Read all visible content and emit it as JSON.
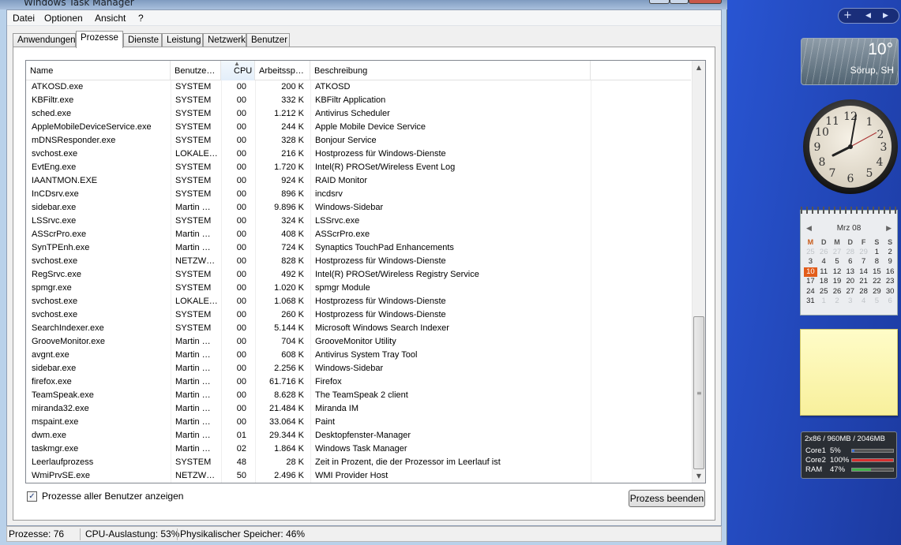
{
  "window": {
    "title": "Windows Task Manager"
  },
  "menu": [
    "Datei",
    "Optionen",
    "Ansicht",
    "?"
  ],
  "tabs": [
    "Anwendungen",
    "Prozesse",
    "Dienste",
    "Leistung",
    "Netzwerk",
    "Benutzer"
  ],
  "active_tab": "Prozesse",
  "columns": {
    "name": "Name",
    "user": "Benutze…",
    "cpu": "CPU",
    "mem": "Arbeitssp…",
    "desc": "Beschreibung"
  },
  "processes": [
    {
      "name": "ATKOSD.exe",
      "user": "SYSTEM",
      "cpu": "00",
      "mem": "200 K",
      "desc": "ATKOSD"
    },
    {
      "name": "KBFiltr.exe",
      "user": "SYSTEM",
      "cpu": "00",
      "mem": "332 K",
      "desc": "KBFiltr Application"
    },
    {
      "name": "sched.exe",
      "user": "SYSTEM",
      "cpu": "00",
      "mem": "1.212 K",
      "desc": "Antivirus Scheduler"
    },
    {
      "name": "AppleMobileDeviceService.exe",
      "user": "SYSTEM",
      "cpu": "00",
      "mem": "244 K",
      "desc": "Apple Mobile Device Service"
    },
    {
      "name": "mDNSResponder.exe",
      "user": "SYSTEM",
      "cpu": "00",
      "mem": "328 K",
      "desc": "Bonjour Service"
    },
    {
      "name": "svchost.exe",
      "user": "LOKALE…",
      "cpu": "00",
      "mem": "216 K",
      "desc": "Hostprozess für Windows-Dienste"
    },
    {
      "name": "EvtEng.exe",
      "user": "SYSTEM",
      "cpu": "00",
      "mem": "1.720 K",
      "desc": "Intel(R) PROSet/Wireless Event Log"
    },
    {
      "name": "IAANTMON.EXE",
      "user": "SYSTEM",
      "cpu": "00",
      "mem": "924 K",
      "desc": "RAID Monitor"
    },
    {
      "name": "InCDsrv.exe",
      "user": "SYSTEM",
      "cpu": "00",
      "mem": "896 K",
      "desc": "incdsrv"
    },
    {
      "name": "sidebar.exe",
      "user": "Martin …",
      "cpu": "00",
      "mem": "9.896 K",
      "desc": "Windows-Sidebar"
    },
    {
      "name": "LSSrvc.exe",
      "user": "SYSTEM",
      "cpu": "00",
      "mem": "324 K",
      "desc": "LSSrvc.exe"
    },
    {
      "name": "ASScrPro.exe",
      "user": "Martin …",
      "cpu": "00",
      "mem": "408 K",
      "desc": "ASScrPro.exe"
    },
    {
      "name": "SynTPEnh.exe",
      "user": "Martin …",
      "cpu": "00",
      "mem": "724 K",
      "desc": "Synaptics TouchPad Enhancements"
    },
    {
      "name": "svchost.exe",
      "user": "NETZW…",
      "cpu": "00",
      "mem": "828 K",
      "desc": "Hostprozess für Windows-Dienste"
    },
    {
      "name": "RegSrvc.exe",
      "user": "SYSTEM",
      "cpu": "00",
      "mem": "492 K",
      "desc": "Intel(R) PROSet/Wireless Registry Service"
    },
    {
      "name": "spmgr.exe",
      "user": "SYSTEM",
      "cpu": "00",
      "mem": "1.020 K",
      "desc": "spmgr Module"
    },
    {
      "name": "svchost.exe",
      "user": "LOKALE…",
      "cpu": "00",
      "mem": "1.068 K",
      "desc": "Hostprozess für Windows-Dienste"
    },
    {
      "name": "svchost.exe",
      "user": "SYSTEM",
      "cpu": "00",
      "mem": "260 K",
      "desc": "Hostprozess für Windows-Dienste"
    },
    {
      "name": "SearchIndexer.exe",
      "user": "SYSTEM",
      "cpu": "00",
      "mem": "5.144 K",
      "desc": "Microsoft Windows Search Indexer"
    },
    {
      "name": "GrooveMonitor.exe",
      "user": "Martin …",
      "cpu": "00",
      "mem": "704 K",
      "desc": "GrooveMonitor Utility"
    },
    {
      "name": "avgnt.exe",
      "user": "Martin …",
      "cpu": "00",
      "mem": "608 K",
      "desc": "Antivirus System Tray Tool"
    },
    {
      "name": "sidebar.exe",
      "user": "Martin …",
      "cpu": "00",
      "mem": "2.256 K",
      "desc": "Windows-Sidebar"
    },
    {
      "name": "firefox.exe",
      "user": "Martin …",
      "cpu": "00",
      "mem": "61.716 K",
      "desc": "Firefox"
    },
    {
      "name": "TeamSpeak.exe",
      "user": "Martin …",
      "cpu": "00",
      "mem": "8.628 K",
      "desc": "The TeamSpeak 2 client"
    },
    {
      "name": "miranda32.exe",
      "user": "Martin …",
      "cpu": "00",
      "mem": "21.484 K",
      "desc": "Miranda IM"
    },
    {
      "name": "mspaint.exe",
      "user": "Martin …",
      "cpu": "00",
      "mem": "33.064 K",
      "desc": "Paint"
    },
    {
      "name": "dwm.exe",
      "user": "Martin …",
      "cpu": "01",
      "mem": "29.344 K",
      "desc": "Desktopfenster-Manager"
    },
    {
      "name": "taskmgr.exe",
      "user": "Martin …",
      "cpu": "02",
      "mem": "1.864 K",
      "desc": "Windows Task Manager"
    },
    {
      "name": "Leerlaufprozess",
      "user": "SYSTEM",
      "cpu": "48",
      "mem": "28 K",
      "desc": "Zeit in Prozent, die der Prozessor im Leerlauf ist"
    },
    {
      "name": "WmiPrvSE.exe",
      "user": "NETZW…",
      "cpu": "50",
      "mem": "2.496 K",
      "desc": "WMI Provider Host"
    }
  ],
  "show_all_users_label": "Prozesse aller Benutzer anzeigen",
  "show_all_users_checked": true,
  "end_process_label": "Prozess beenden",
  "status": {
    "processes": "Prozesse: 76",
    "cpu": "CPU-Auslastung: 53%",
    "memory": "Physikalischer Speicher: 46%"
  },
  "gadgets": {
    "weather": {
      "temp": "10°",
      "location": "Sörup, SH"
    },
    "calendar": {
      "month": "Mrz 08",
      "weekdays": [
        "M",
        "D",
        "M",
        "D",
        "F",
        "S",
        "S"
      ],
      "weeks": [
        [
          {
            "d": "25",
            "m": 1
          },
          {
            "d": "26",
            "m": 1
          },
          {
            "d": "27",
            "m": 1
          },
          {
            "d": "28",
            "m": 1
          },
          {
            "d": "29",
            "m": 1
          },
          {
            "d": "1"
          },
          {
            "d": "2"
          }
        ],
        [
          {
            "d": "3"
          },
          {
            "d": "4"
          },
          {
            "d": "5"
          },
          {
            "d": "6"
          },
          {
            "d": "7"
          },
          {
            "d": "8"
          },
          {
            "d": "9"
          }
        ],
        [
          {
            "d": "10",
            "t": 1
          },
          {
            "d": "11"
          },
          {
            "d": "12"
          },
          {
            "d": "13"
          },
          {
            "d": "14"
          },
          {
            "d": "15"
          },
          {
            "d": "16"
          }
        ],
        [
          {
            "d": "17"
          },
          {
            "d": "18"
          },
          {
            "d": "19"
          },
          {
            "d": "20"
          },
          {
            "d": "21"
          },
          {
            "d": "22"
          },
          {
            "d": "23"
          }
        ],
        [
          {
            "d": "24"
          },
          {
            "d": "25"
          },
          {
            "d": "26"
          },
          {
            "d": "27"
          },
          {
            "d": "28"
          },
          {
            "d": "29"
          },
          {
            "d": "30"
          }
        ],
        [
          {
            "d": "31"
          },
          {
            "d": "1",
            "m": 1
          },
          {
            "d": "2",
            "m": 1
          },
          {
            "d": "3",
            "m": 1
          },
          {
            "d": "4",
            "m": 1
          },
          {
            "d": "5",
            "m": 1
          },
          {
            "d": "6",
            "m": 1
          }
        ]
      ]
    },
    "meter": {
      "header": "2x86 / 960MB / 2046MB",
      "rows": [
        {
          "label": "Core1",
          "value": "5%",
          "level": 0.05,
          "color": "#3b6fd6"
        },
        {
          "label": "Core2",
          "value": "100%",
          "level": 1.0,
          "color": "#d83030"
        },
        {
          "label": "RAM",
          "value": "47%",
          "level": 0.47,
          "color": "#3fb04a"
        }
      ]
    }
  }
}
